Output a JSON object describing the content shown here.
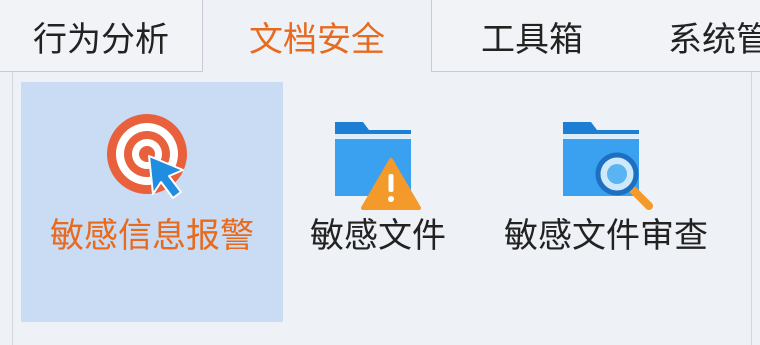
{
  "tabs": [
    {
      "label": "行为分析",
      "active": false
    },
    {
      "label": "文档安全",
      "active": true
    },
    {
      "label": "工具箱",
      "active": false
    },
    {
      "label": "系统管",
      "active": false
    }
  ],
  "tools": [
    {
      "label": "敏感信息报警",
      "icon": "target-cursor-icon",
      "selected": true
    },
    {
      "label": "敏感文件",
      "icon": "folder-warning-icon",
      "selected": false
    },
    {
      "label": "敏感文件审查",
      "icon": "folder-search-icon",
      "selected": false
    }
  ],
  "colors": {
    "accent": "#e86a1e",
    "selection": "#c9dcf3",
    "folder_blue": "#2a8ee6",
    "warning_orange": "#f39a2a"
  }
}
